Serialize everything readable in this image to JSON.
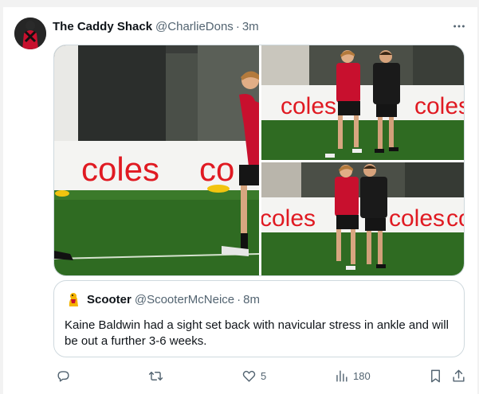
{
  "tweet": {
    "display_name": "The Caddy Shack",
    "handle": "@CharlieDons",
    "separator": "·",
    "time": "3m",
    "more_icon": "more-horizontal-icon"
  },
  "media": {
    "photos": [
      {
        "name": "photo-main",
        "signage": "coles"
      },
      {
        "name": "photo-top-right",
        "signage": "coles"
      },
      {
        "name": "photo-bottom-right",
        "signage": "coles"
      }
    ]
  },
  "quote": {
    "display_name": "Scooter",
    "handle": "@ScooterMcNeice",
    "separator": "·",
    "time": "8m",
    "text": "Kaine Baldwin had a sight set back with navicular stress in ankle and will be out a further 3-6 weeks."
  },
  "actions": {
    "reply": {
      "icon": "reply-icon",
      "count": ""
    },
    "retweet": {
      "icon": "retweet-icon",
      "count": ""
    },
    "like": {
      "icon": "like-icon",
      "count": "5"
    },
    "views": {
      "icon": "views-icon",
      "count": "180"
    },
    "bookmark": {
      "icon": "bookmark-icon"
    },
    "share": {
      "icon": "share-icon"
    }
  },
  "colors": {
    "text_primary": "#0f1419",
    "text_secondary": "#536471",
    "border": "#cfd9de",
    "coles_red": "#e01a22",
    "jersey_red": "#d11a24"
  }
}
